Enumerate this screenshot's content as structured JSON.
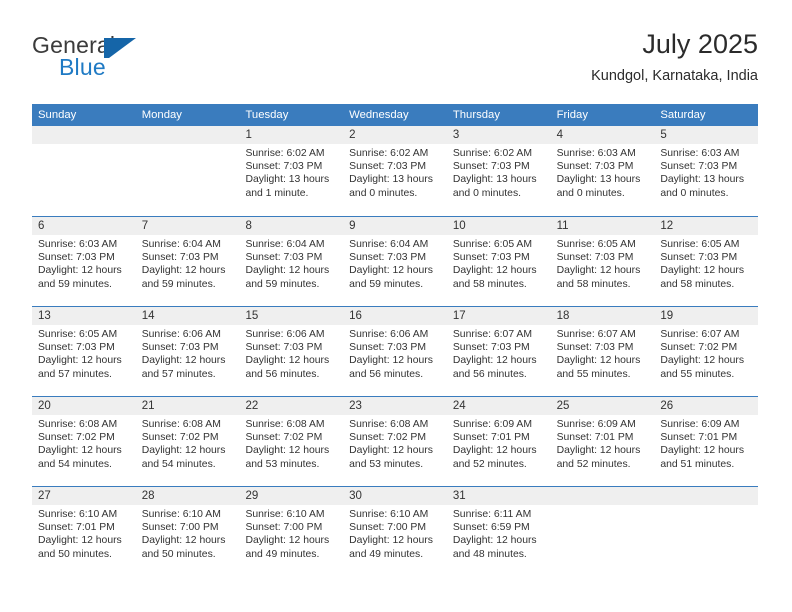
{
  "brand": {
    "name_part1": "General",
    "name_part2": "Blue",
    "flag_icon": "blue-flag-icon",
    "accent_color": "#1f7ac4"
  },
  "header": {
    "title": "July 2025",
    "location": "Kundgol, Karnataka, India"
  },
  "theme": {
    "header_row_color": "#3a7cbe",
    "daynum_band_color": "#efefef",
    "text_color": "#333333"
  },
  "weekdays": [
    "Sunday",
    "Monday",
    "Tuesday",
    "Wednesday",
    "Thursday",
    "Friday",
    "Saturday"
  ],
  "weeks": [
    [
      {
        "day": "",
        "empty": true,
        "sunrise": "",
        "sunset": "",
        "daylight1": "",
        "daylight2": ""
      },
      {
        "day": "",
        "empty": true,
        "sunrise": "",
        "sunset": "",
        "daylight1": "",
        "daylight2": ""
      },
      {
        "day": "1",
        "sunrise": "Sunrise: 6:02 AM",
        "sunset": "Sunset: 7:03 PM",
        "daylight1": "Daylight: 13 hours",
        "daylight2": "and 1 minute."
      },
      {
        "day": "2",
        "sunrise": "Sunrise: 6:02 AM",
        "sunset": "Sunset: 7:03 PM",
        "daylight1": "Daylight: 13 hours",
        "daylight2": "and 0 minutes."
      },
      {
        "day": "3",
        "sunrise": "Sunrise: 6:02 AM",
        "sunset": "Sunset: 7:03 PM",
        "daylight1": "Daylight: 13 hours",
        "daylight2": "and 0 minutes."
      },
      {
        "day": "4",
        "sunrise": "Sunrise: 6:03 AM",
        "sunset": "Sunset: 7:03 PM",
        "daylight1": "Daylight: 13 hours",
        "daylight2": "and 0 minutes."
      },
      {
        "day": "5",
        "sunrise": "Sunrise: 6:03 AM",
        "sunset": "Sunset: 7:03 PM",
        "daylight1": "Daylight: 13 hours",
        "daylight2": "and 0 minutes."
      }
    ],
    [
      {
        "day": "6",
        "sunrise": "Sunrise: 6:03 AM",
        "sunset": "Sunset: 7:03 PM",
        "daylight1": "Daylight: 12 hours",
        "daylight2": "and 59 minutes."
      },
      {
        "day": "7",
        "sunrise": "Sunrise: 6:04 AM",
        "sunset": "Sunset: 7:03 PM",
        "daylight1": "Daylight: 12 hours",
        "daylight2": "and 59 minutes."
      },
      {
        "day": "8",
        "sunrise": "Sunrise: 6:04 AM",
        "sunset": "Sunset: 7:03 PM",
        "daylight1": "Daylight: 12 hours",
        "daylight2": "and 59 minutes."
      },
      {
        "day": "9",
        "sunrise": "Sunrise: 6:04 AM",
        "sunset": "Sunset: 7:03 PM",
        "daylight1": "Daylight: 12 hours",
        "daylight2": "and 59 minutes."
      },
      {
        "day": "10",
        "sunrise": "Sunrise: 6:05 AM",
        "sunset": "Sunset: 7:03 PM",
        "daylight1": "Daylight: 12 hours",
        "daylight2": "and 58 minutes."
      },
      {
        "day": "11",
        "sunrise": "Sunrise: 6:05 AM",
        "sunset": "Sunset: 7:03 PM",
        "daylight1": "Daylight: 12 hours",
        "daylight2": "and 58 minutes."
      },
      {
        "day": "12",
        "sunrise": "Sunrise: 6:05 AM",
        "sunset": "Sunset: 7:03 PM",
        "daylight1": "Daylight: 12 hours",
        "daylight2": "and 58 minutes."
      }
    ],
    [
      {
        "day": "13",
        "sunrise": "Sunrise: 6:05 AM",
        "sunset": "Sunset: 7:03 PM",
        "daylight1": "Daylight: 12 hours",
        "daylight2": "and 57 minutes."
      },
      {
        "day": "14",
        "sunrise": "Sunrise: 6:06 AM",
        "sunset": "Sunset: 7:03 PM",
        "daylight1": "Daylight: 12 hours",
        "daylight2": "and 57 minutes."
      },
      {
        "day": "15",
        "sunrise": "Sunrise: 6:06 AM",
        "sunset": "Sunset: 7:03 PM",
        "daylight1": "Daylight: 12 hours",
        "daylight2": "and 56 minutes."
      },
      {
        "day": "16",
        "sunrise": "Sunrise: 6:06 AM",
        "sunset": "Sunset: 7:03 PM",
        "daylight1": "Daylight: 12 hours",
        "daylight2": "and 56 minutes."
      },
      {
        "day": "17",
        "sunrise": "Sunrise: 6:07 AM",
        "sunset": "Sunset: 7:03 PM",
        "daylight1": "Daylight: 12 hours",
        "daylight2": "and 56 minutes."
      },
      {
        "day": "18",
        "sunrise": "Sunrise: 6:07 AM",
        "sunset": "Sunset: 7:03 PM",
        "daylight1": "Daylight: 12 hours",
        "daylight2": "and 55 minutes."
      },
      {
        "day": "19",
        "sunrise": "Sunrise: 6:07 AM",
        "sunset": "Sunset: 7:02 PM",
        "daylight1": "Daylight: 12 hours",
        "daylight2": "and 55 minutes."
      }
    ],
    [
      {
        "day": "20",
        "sunrise": "Sunrise: 6:08 AM",
        "sunset": "Sunset: 7:02 PM",
        "daylight1": "Daylight: 12 hours",
        "daylight2": "and 54 minutes."
      },
      {
        "day": "21",
        "sunrise": "Sunrise: 6:08 AM",
        "sunset": "Sunset: 7:02 PM",
        "daylight1": "Daylight: 12 hours",
        "daylight2": "and 54 minutes."
      },
      {
        "day": "22",
        "sunrise": "Sunrise: 6:08 AM",
        "sunset": "Sunset: 7:02 PM",
        "daylight1": "Daylight: 12 hours",
        "daylight2": "and 53 minutes."
      },
      {
        "day": "23",
        "sunrise": "Sunrise: 6:08 AM",
        "sunset": "Sunset: 7:02 PM",
        "daylight1": "Daylight: 12 hours",
        "daylight2": "and 53 minutes."
      },
      {
        "day": "24",
        "sunrise": "Sunrise: 6:09 AM",
        "sunset": "Sunset: 7:01 PM",
        "daylight1": "Daylight: 12 hours",
        "daylight2": "and 52 minutes."
      },
      {
        "day": "25",
        "sunrise": "Sunrise: 6:09 AM",
        "sunset": "Sunset: 7:01 PM",
        "daylight1": "Daylight: 12 hours",
        "daylight2": "and 52 minutes."
      },
      {
        "day": "26",
        "sunrise": "Sunrise: 6:09 AM",
        "sunset": "Sunset: 7:01 PM",
        "daylight1": "Daylight: 12 hours",
        "daylight2": "and 51 minutes."
      }
    ],
    [
      {
        "day": "27",
        "sunrise": "Sunrise: 6:10 AM",
        "sunset": "Sunset: 7:01 PM",
        "daylight1": "Daylight: 12 hours",
        "daylight2": "and 50 minutes."
      },
      {
        "day": "28",
        "sunrise": "Sunrise: 6:10 AM",
        "sunset": "Sunset: 7:00 PM",
        "daylight1": "Daylight: 12 hours",
        "daylight2": "and 50 minutes."
      },
      {
        "day": "29",
        "sunrise": "Sunrise: 6:10 AM",
        "sunset": "Sunset: 7:00 PM",
        "daylight1": "Daylight: 12 hours",
        "daylight2": "and 49 minutes."
      },
      {
        "day": "30",
        "sunrise": "Sunrise: 6:10 AM",
        "sunset": "Sunset: 7:00 PM",
        "daylight1": "Daylight: 12 hours",
        "daylight2": "and 49 minutes."
      },
      {
        "day": "31",
        "sunrise": "Sunrise: 6:11 AM",
        "sunset": "Sunset: 6:59 PM",
        "daylight1": "Daylight: 12 hours",
        "daylight2": "and 48 minutes."
      },
      {
        "day": "",
        "empty": true,
        "sunrise": "",
        "sunset": "",
        "daylight1": "",
        "daylight2": ""
      },
      {
        "day": "",
        "empty": true,
        "sunrise": "",
        "sunset": "",
        "daylight1": "",
        "daylight2": ""
      }
    ]
  ]
}
